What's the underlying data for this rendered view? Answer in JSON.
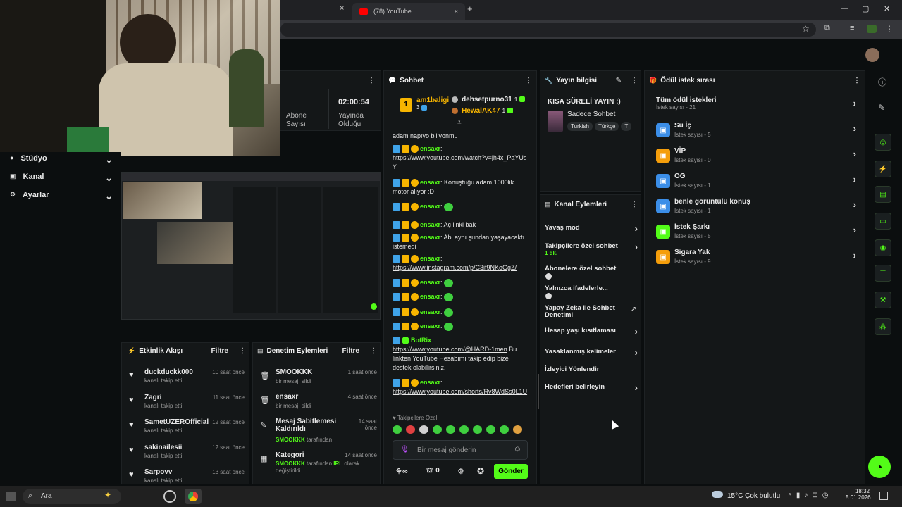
{
  "browser": {
    "tab_youtube": "(78) YouTube",
    "new_tab": "+",
    "close": "×"
  },
  "sidebar": {
    "items": [
      {
        "label": "Stüdyo"
      },
      {
        "label": "Kanal"
      },
      {
        "label": "Ayarlar"
      }
    ]
  },
  "stats": {
    "subs_label_a": "Abone",
    "subs_label_b": "Sayısı",
    "time": "02:00:54",
    "live_a": "Yayında",
    "live_b": "Olduğu"
  },
  "activity": {
    "title": "Etkinlik Akışı",
    "filter": "Filtre",
    "items": [
      {
        "user": "duckduckk000",
        "action": "kanalı takip etti",
        "time": "10 saat önce"
      },
      {
        "user": "Zagri",
        "action": "kanalı takip etti",
        "time": "11 saat önce"
      },
      {
        "user": "SametUZEROfficial",
        "action": "kanalı takip etti",
        "time": "12 saat önce"
      },
      {
        "user": "sakinailesii",
        "action": "kanalı takip etti",
        "time": "12 saat önce"
      },
      {
        "user": "Sarpovv",
        "action": "kanalı takip etti",
        "time": "13 saat önce"
      }
    ]
  },
  "moderation": {
    "title": "Denetim Eylemleri",
    "filter": "Filtre",
    "items": [
      {
        "user": "SMOOKKK",
        "action": "bir mesajı sildi",
        "time": "1 saat önce"
      },
      {
        "user": "ensaxr",
        "action": "bir mesajı sildi",
        "time": "4 saat önce"
      },
      {
        "user": "Mesaj Sabitlemesi Kaldırıldı",
        "action_user": "SMOOKKK",
        "action": "tarafından",
        "time": "14 saat önce"
      },
      {
        "user": "Kategori",
        "action_user": "SMOOKKK",
        "action": "tarafından",
        "action_cat": "IRL",
        "action_end": "olarak değiştirildi",
        "time": "14 saat önce"
      }
    ]
  },
  "chat": {
    "title": "Sohbet",
    "top1_user": "am1baligi",
    "top1_count": "3",
    "top2_user": "dehsetpurno31",
    "top2_count": "1",
    "top3_user": "HewalAK47",
    "top3_count": "1",
    "first_line": "adam napıyo biliyonmu",
    "messages": [
      {
        "user": "ensaxr",
        "text": "",
        "link": "https://www.youtube.com/watch?v=jh4x_PaYUsY"
      },
      {
        "user": "ensaxr",
        "text": "Konuştuğu adam 1000lik motor alıyor :D"
      },
      {
        "user": "ensaxr",
        "emote": true
      },
      {
        "user": "ensaxr",
        "text": "Aç linki bak"
      },
      {
        "user": "ensaxr",
        "text": "Abi aynı şundan yaşayacaktı istemedi"
      },
      {
        "user": "ensaxr",
        "link": "https://www.instagram.com/p/C3if9NKoGgZ/"
      },
      {
        "user": "ensaxr",
        "emote": true
      },
      {
        "user": "ensaxr",
        "emote": true
      },
      {
        "user": "ensaxr",
        "emote": true
      },
      {
        "user": "ensaxr",
        "emote": true
      }
    ],
    "botrix_user": "BotRix",
    "botrix_link": "https://www.youtube.com/@HARD-1men",
    "botrix_text": "Bu linkten YouTube Hesabımı takip edip bize destek olabilirsiniz.",
    "last_user": "ensaxr",
    "last_link": "https://www.youtube.com/shorts/Rv8WdSs0L1U",
    "followers_label": "Takipçilere Özel",
    "input_placeholder": "Bir mesaj gönderin",
    "points": "0",
    "send": "Gönder"
  },
  "stream_info": {
    "title": "Yayın bilgisi",
    "stream_title": "KISA SÜRELİ YAYIN :)",
    "category": "Sadece Sohbet",
    "tags": [
      "Turkish",
      "Türkçe"
    ]
  },
  "channel_actions": {
    "title": "Kanal Eylemleri",
    "items": [
      {
        "label": "Yavaş mod",
        "kind": "chevron"
      },
      {
        "label": "Takipçilere özel sohbet",
        "sub": "1 dk.",
        "kind": "chevron"
      },
      {
        "label": "Abonelere özel sohbet",
        "kind": "toggle"
      },
      {
        "label": "Yalnızca ifadelerle...",
        "kind": "toggle"
      },
      {
        "label": "Yapay Zeka ile Sohbet Denetimi",
        "kind": "external"
      },
      {
        "label": "Hesap yaşı kısıtlaması",
        "kind": "chevron"
      },
      {
        "label": "Yasaklanmış kelimeler",
        "kind": "chevron"
      },
      {
        "label": "İzleyici Yönlendir",
        "kind": "none"
      },
      {
        "label": "Hedefleri belirleyin",
        "kind": "chevron"
      }
    ]
  },
  "rewards": {
    "title": "Ödül istek sırası",
    "all_label": "Tüm ödül istekleri",
    "all_count": "İstek sayısı - 21",
    "items": [
      {
        "label": "Su İç",
        "count": "İstek sayısı - 5",
        "color": "#3b8ee8"
      },
      {
        "label": "VİP",
        "count": "İstek sayısı - 0",
        "color": "#f59e0b"
      },
      {
        "label": "OG",
        "count": "İstek sayısı - 1",
        "color": "#3b8ee8"
      },
      {
        "label": "benle görüntülü konuş",
        "count": "İstek sayısı - 1",
        "color": "#3b8ee8"
      },
      {
        "label": "İstek Şarkı",
        "count": "İstek sayısı - 5",
        "color": "#53fc18"
      },
      {
        "label": "Sigara Yak",
        "count": "İstek sayısı - 9",
        "color": "#f59e0b"
      }
    ]
  },
  "taskbar": {
    "search": "Ara",
    "weather": "15°C  Çok bulutlu",
    "time": "18:32",
    "date": "5.01.2026"
  },
  "colors": {
    "accent": "#53fc18",
    "panel": "#141718",
    "bg": "#0b0e0f"
  }
}
